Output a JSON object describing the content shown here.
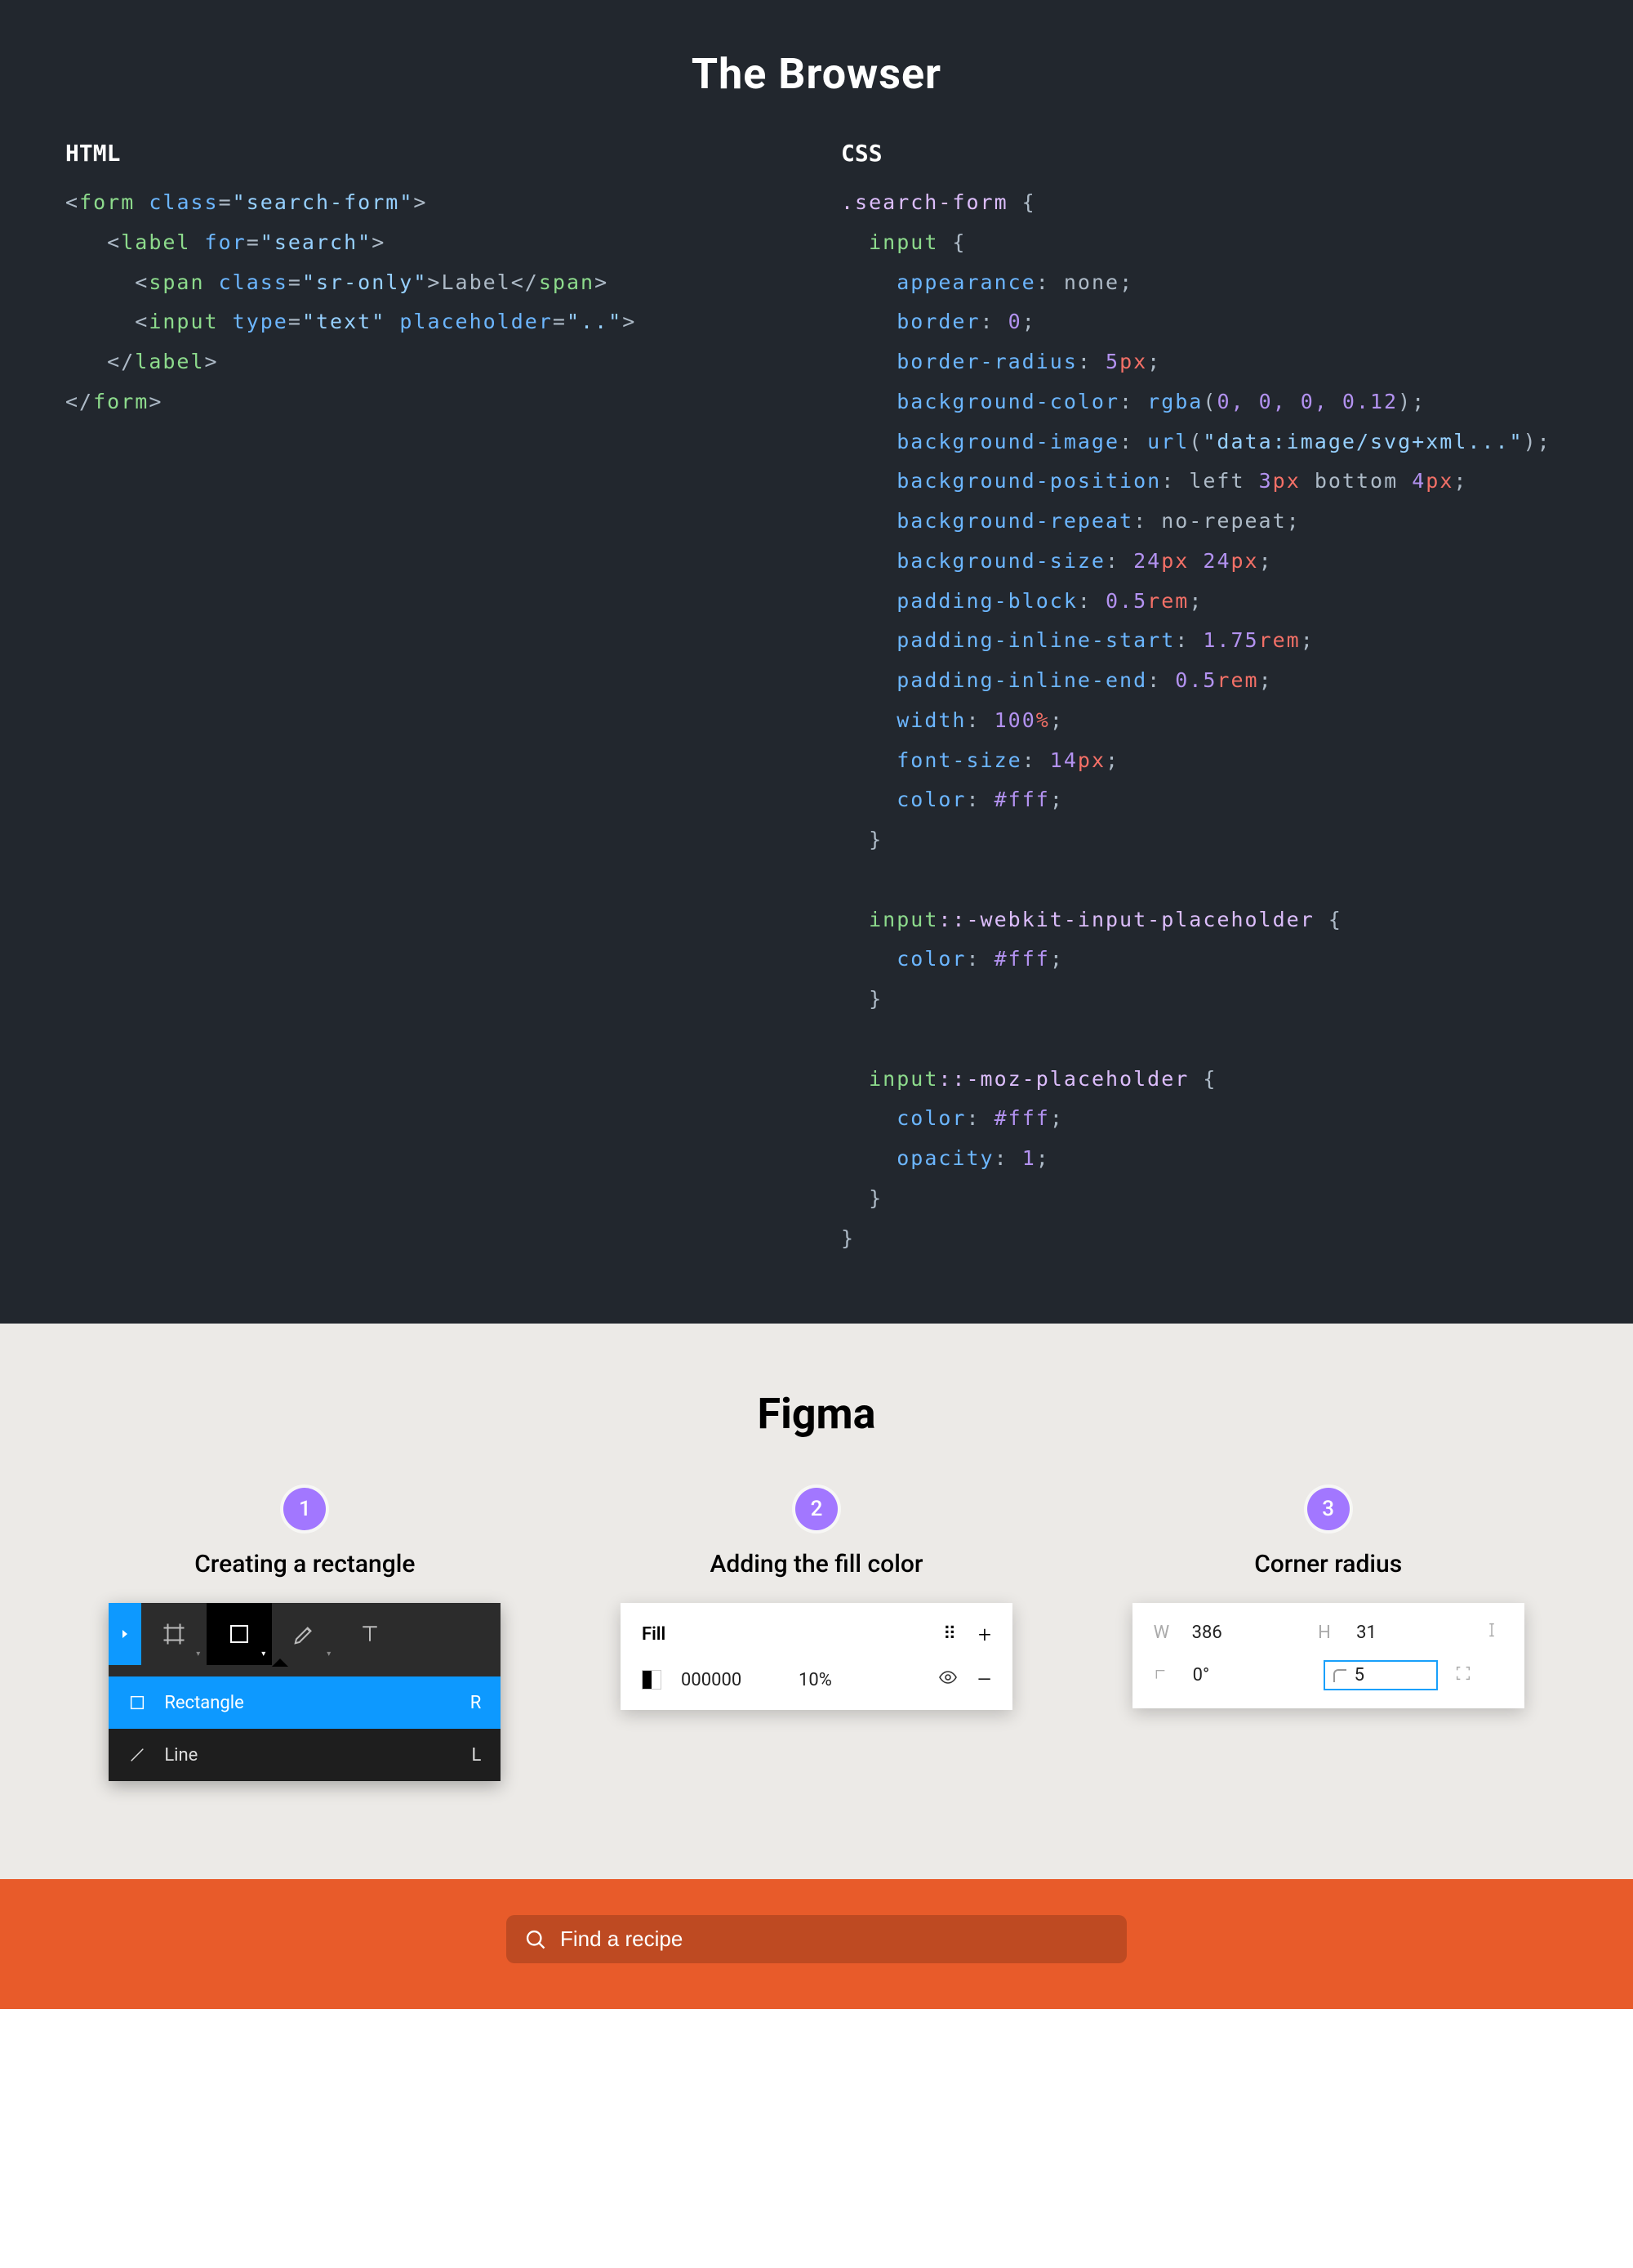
{
  "browser": {
    "title": "The Browser",
    "html_label": "HTML",
    "css_label": "CSS",
    "html_code": {
      "form_tag": "form",
      "form_class": "search-form",
      "label_tag": "label",
      "label_for": "search",
      "span_tag": "span",
      "span_class": "sr-only",
      "span_text": "Label",
      "input_tag": "input",
      "input_type": "text",
      "input_placeholder": ".."
    },
    "css_code": {
      "selector": ".search-form",
      "input_selector": "input",
      "props": {
        "appearance": "none",
        "border": "0",
        "border_radius_val": "5",
        "border_radius_unit": "px",
        "bg_color_fn": "rgba",
        "bg_color_args": "0, 0, 0, 0.12",
        "bg_image_fn": "url",
        "bg_image_arg": "\"data:image/svg+xml...\"",
        "bg_position_left": "left",
        "bg_position_lval": "3",
        "bg_position_lunit": "px",
        "bg_position_bottom": "bottom",
        "bg_position_bval": "4",
        "bg_position_bunit": "px",
        "bg_repeat": "no-repeat",
        "bg_size_v1": "24",
        "bg_size_u1": "px",
        "bg_size_v2": "24",
        "bg_size_u2": "px",
        "padding_block_v": "0.5",
        "padding_block_u": "rem",
        "padding_inline_start_v": "1.75",
        "padding_inline_start_u": "rem",
        "padding_inline_end_v": "0.5",
        "padding_inline_end_u": "rem",
        "width_v": "100",
        "width_u": "%",
        "font_size_v": "14",
        "font_size_u": "px",
        "color": "#fff"
      },
      "webkit_sel": "input::-webkit-input-placeholder",
      "webkit_color": "#fff",
      "moz_sel": "input::-moz-placeholder",
      "moz_color": "#fff",
      "moz_opacity": "1"
    }
  },
  "figma": {
    "title": "Figma",
    "steps": [
      {
        "num": "1",
        "title": "Creating a rectangle"
      },
      {
        "num": "2",
        "title": "Adding the fill color"
      },
      {
        "num": "3",
        "title": "Corner radius"
      }
    ],
    "toolbar_menu": {
      "rectangle_label": "Rectangle",
      "rectangle_shortcut": "R",
      "line_label": "Line",
      "line_shortcut": "L"
    },
    "fill_panel": {
      "title": "Fill",
      "hex": "000000",
      "opacity": "10%"
    },
    "props_panel": {
      "w_label": "W",
      "w_value": "386",
      "h_label": "H",
      "h_value": "31",
      "rotation_value": "0°",
      "radius_value": "5"
    }
  },
  "search": {
    "placeholder": "Find a recipe"
  }
}
